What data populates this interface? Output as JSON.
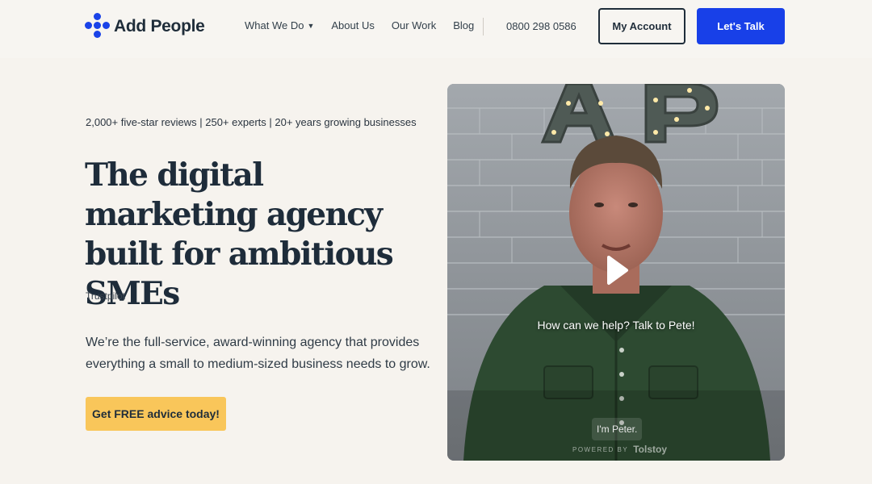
{
  "header": {
    "logo_text": "Add People",
    "nav": [
      {
        "label": "What We Do",
        "has_dropdown": true
      },
      {
        "label": "About Us"
      },
      {
        "label": "Our Work"
      },
      {
        "label": "Blog"
      }
    ],
    "phone": "0800 298 0586",
    "account_label": "My Account",
    "talk_label": "Let's Talk"
  },
  "hero": {
    "stats": "2,000+ five-star reviews | 250+ experts | 20+ years growing businesses",
    "title": "The digital marketing agency built for ambitious SMEs",
    "trustpilot": "Trustpilot",
    "description": "We’re the full-service, award-winning agency that provides everything a small to medium-sized business needs to grow.",
    "cta_label": "Get FREE advice today!"
  },
  "video": {
    "caption": "How can we help? Talk to Pete!",
    "subtitle": "I'm Peter.",
    "powered_by": "POWERED BY",
    "powered_brand": "Tolstoy",
    "sign_letters": "AP"
  },
  "colors": {
    "primary_blue": "#1840e8",
    "cta_yellow": "#f9c65a",
    "text_dark": "#1e2c3a",
    "background": "#f6f3ee"
  }
}
